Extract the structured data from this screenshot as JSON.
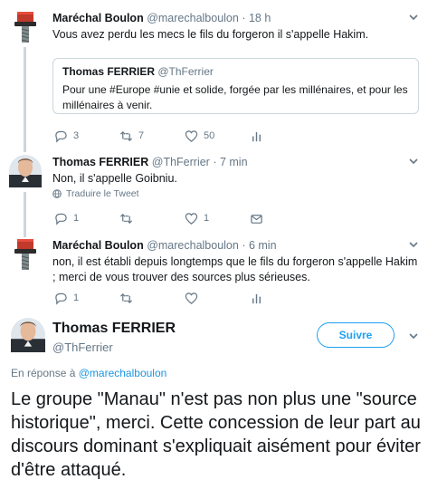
{
  "tweets": [
    {
      "name": "Maréchal Boulon",
      "handle": "@marechalboulon",
      "time": "· 18 h",
      "text": "Vous avez perdu les mecs le fils du forgeron il s'appelle Hakim.",
      "avatar": "bolt-avatar",
      "quote": {
        "name": "Thomas FERRIER",
        "handle": "@ThFerrier",
        "text": "Pour une #Europe #unie et solide, forgée par les millénaires, et pour les millénaires à venir."
      },
      "counts": {
        "reply": "3",
        "retweet": "7",
        "like": "50"
      }
    },
    {
      "name": "Thomas FERRIER",
      "handle": "@ThFerrier",
      "time": "· 7 min",
      "text": "Non, il s'appelle Goibniu.",
      "avatar": "person-avatar",
      "translate": "Traduire le Tweet",
      "counts": {
        "reply": "1",
        "retweet": "",
        "like": "1"
      }
    },
    {
      "name": "Maréchal Boulon",
      "handle": "@marechalboulon",
      "time": "· 6 min",
      "text": "non, il est établi depuis longtemps que le fils du forgeron s'appelle Hakim ; merci de vous trouver des sources plus sérieuses.",
      "avatar": "bolt-avatar",
      "counts": {
        "reply": "1",
        "retweet": "",
        "like": ""
      }
    }
  ],
  "main_tweet": {
    "name": "Thomas FERRIER",
    "handle": "@ThFerrier",
    "follow_label": "Suivre",
    "reply_prefix": "En réponse à",
    "reply_mention": "@marechalboulon",
    "text": "Le groupe \"Manau\" n'est pas non plus une \"source historique\", merci. Cette concession de leur part au discours dominant s'expliquait aisément pour éviter d'être attaqué."
  },
  "colors": {
    "accent": "#1da1f2",
    "secondary_text": "#657786",
    "thread_line": "#ccd6dd"
  }
}
